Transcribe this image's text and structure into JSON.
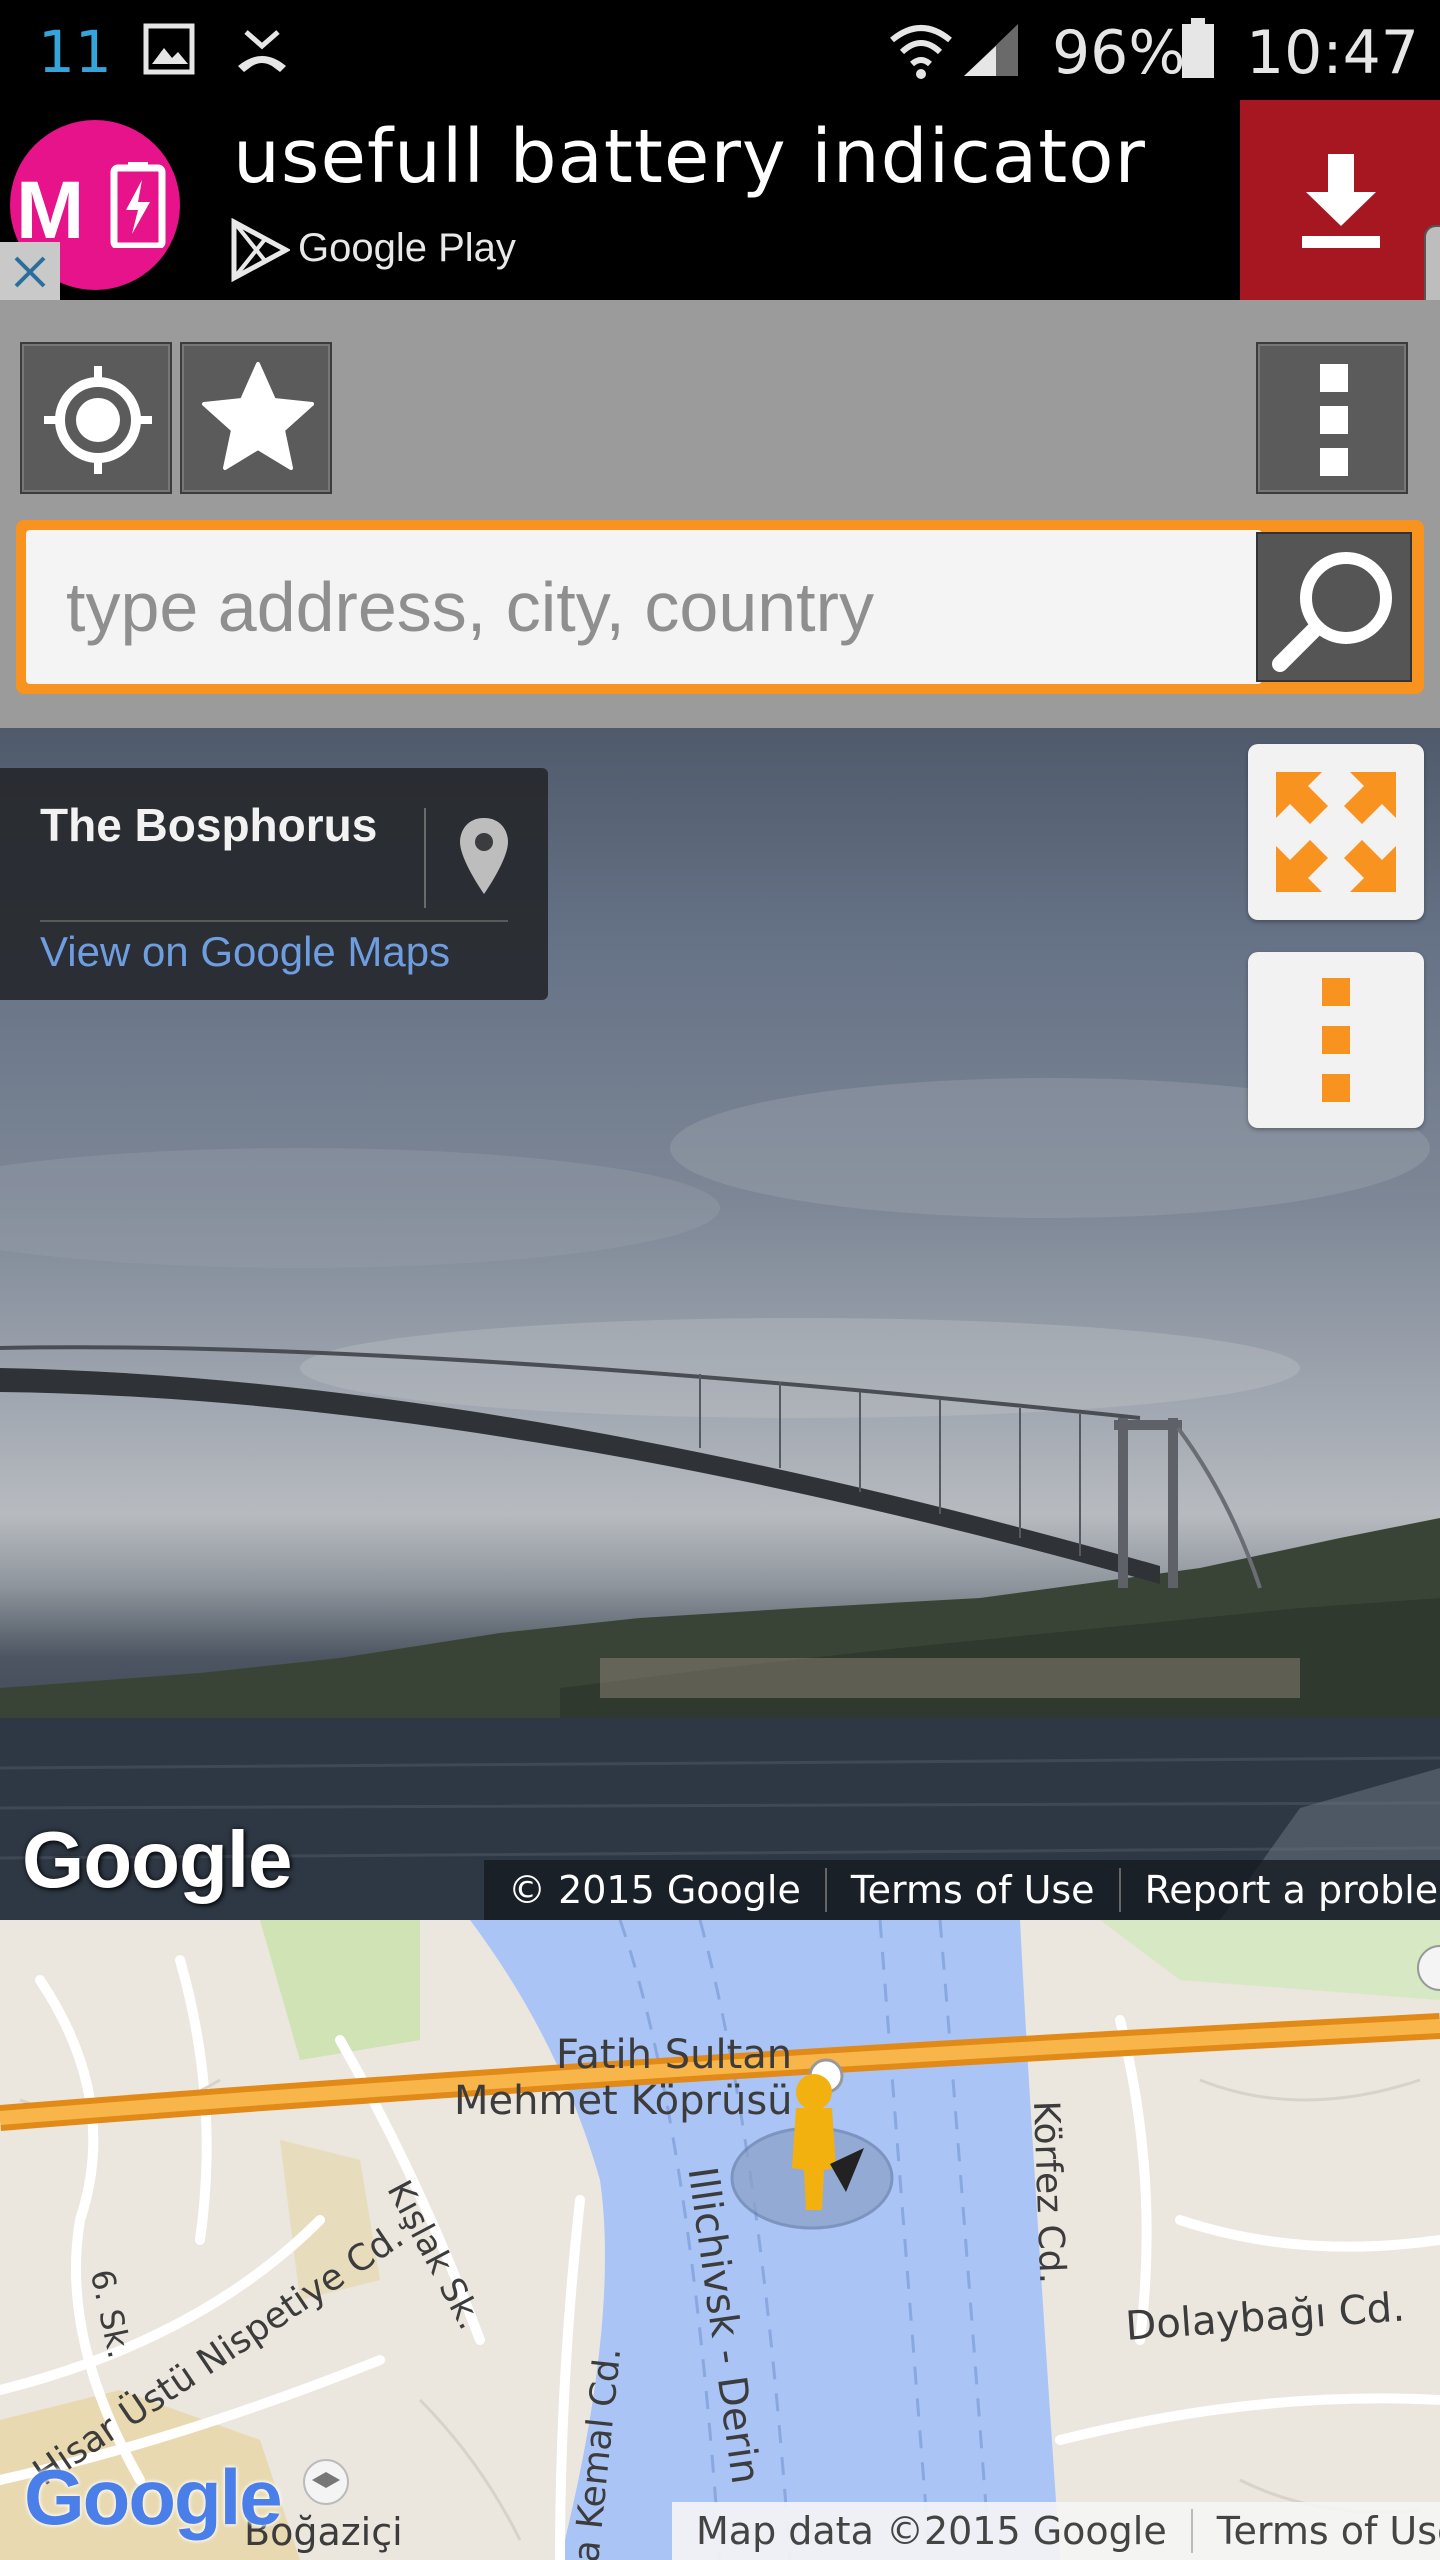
{
  "status_bar": {
    "notification_count": "11",
    "battery_percent": "96%",
    "time": "10:47",
    "icons": [
      "gallery-icon",
      "missed-call-icon",
      "wifi-icon",
      "signal-icon",
      "battery-icon"
    ]
  },
  "ad": {
    "logo_text": "M",
    "title": "usefull battery indicator",
    "store": "Google Play",
    "download_icon": "download-icon",
    "close_icon": "close-icon",
    "download_color": "#a71722"
  },
  "toolbar": {
    "locate_icon": "crosshair-icon",
    "favorites_icon": "star-icon",
    "menu_icon": "more-vertical-icon",
    "accent_color": "#f7931e"
  },
  "search": {
    "placeholder": "type address, city, country",
    "button_icon": "search-icon"
  },
  "street_view": {
    "place_title": "The Bosphorus",
    "view_link": "View on Google Maps",
    "pin_icon": "map-pin-icon",
    "fullscreen_icon": "expand-icon",
    "options_icon": "more-vertical-icon",
    "logo": "Google",
    "attribution": [
      "© 2015 Google",
      "Terms of Use",
      "Report a problem"
    ]
  },
  "map": {
    "labels": {
      "bridge_line1": "Fatih Sultan",
      "bridge_line2": "Mehmet Köprüsü",
      "strait": "Illichivsk - Derin",
      "korfez": "Körfez Cd.",
      "dolaybagi": "Dolaybağı Cd.",
      "kislak": "Kışlak Sk.",
      "nispetiye": "Hisar Üstü Nispetiye Cd.",
      "six_sk": "6. Sk.",
      "kemal": "a Kemal Cd.",
      "bogazici": "Boğaziçi"
    },
    "logo": "Google",
    "attribution": [
      "Map data ©2015 Google",
      "Terms of Use"
    ]
  }
}
